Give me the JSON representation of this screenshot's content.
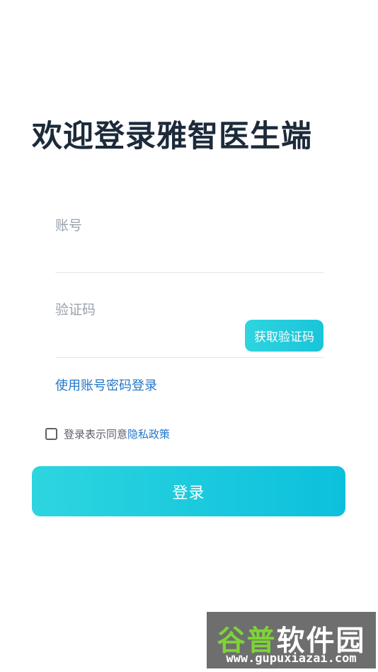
{
  "header": {
    "title": "欢迎登录雅智医生端"
  },
  "form": {
    "account_label": "账号",
    "code_label": "验证码",
    "get_code_label": "获取验证码",
    "switch_login_label": "使用账号密码登录",
    "agree_prefix": "登录表示同意",
    "privacy_label": "隐私政策",
    "login_label": "登录",
    "agree_checked": false
  },
  "watermark": {
    "brand_green": "谷普",
    "brand_white": "软件园",
    "url": "www.gupuxiazai.com"
  },
  "colors": {
    "title": "#1c2a3a",
    "link": "#2277c8",
    "accent_start": "#2dd5df",
    "accent_end": "#0cc0dc"
  }
}
